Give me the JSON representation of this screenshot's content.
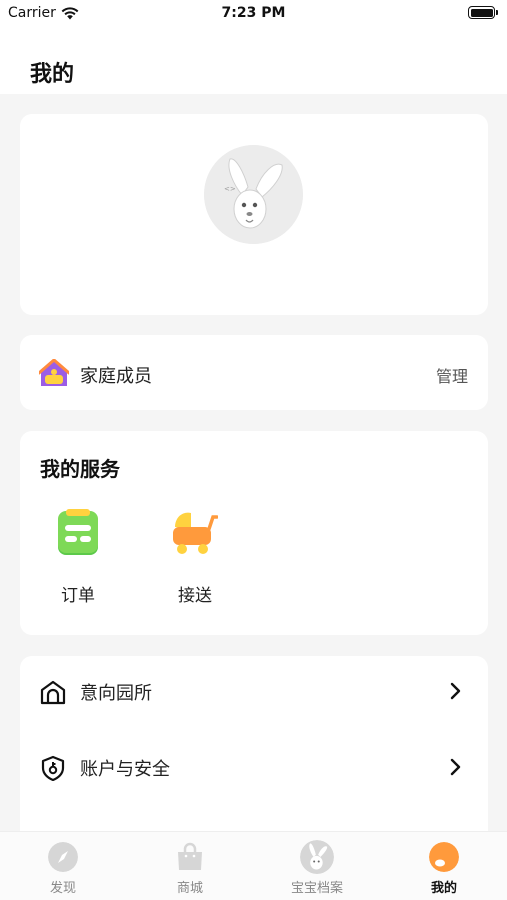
{
  "status_bar": {
    "carrier": "Carrier",
    "time": "7:23 PM"
  },
  "header": {
    "title": "我的"
  },
  "profile": {
    "avatar_icon": "bunny-avatar-icon"
  },
  "family": {
    "label": "家庭成员",
    "action": "管理",
    "icon": "house-icon"
  },
  "services": {
    "title": "我的服务",
    "items": [
      {
        "label": "订单",
        "icon": "order-clipboard-icon",
        "color": "#7ed957"
      },
      {
        "label": "接送",
        "icon": "stroller-icon",
        "color": "#ff9a3c"
      }
    ]
  },
  "menu": {
    "items": [
      {
        "label": "意向园所",
        "icon": "school-building-icon"
      },
      {
        "label": "账户与安全",
        "icon": "shield-key-icon"
      }
    ]
  },
  "tabbar": {
    "items": [
      {
        "label": "发现",
        "icon": "compass-icon",
        "active": false
      },
      {
        "label": "商城",
        "icon": "shopping-bag-icon",
        "active": false
      },
      {
        "label": "宝宝档案",
        "icon": "bunny-icon",
        "active": false
      },
      {
        "label": "我的",
        "icon": "profile-face-icon",
        "active": true
      }
    ]
  },
  "colors": {
    "accent": "#ff9a3c",
    "background": "#f5f5f5",
    "card": "#ffffff"
  }
}
